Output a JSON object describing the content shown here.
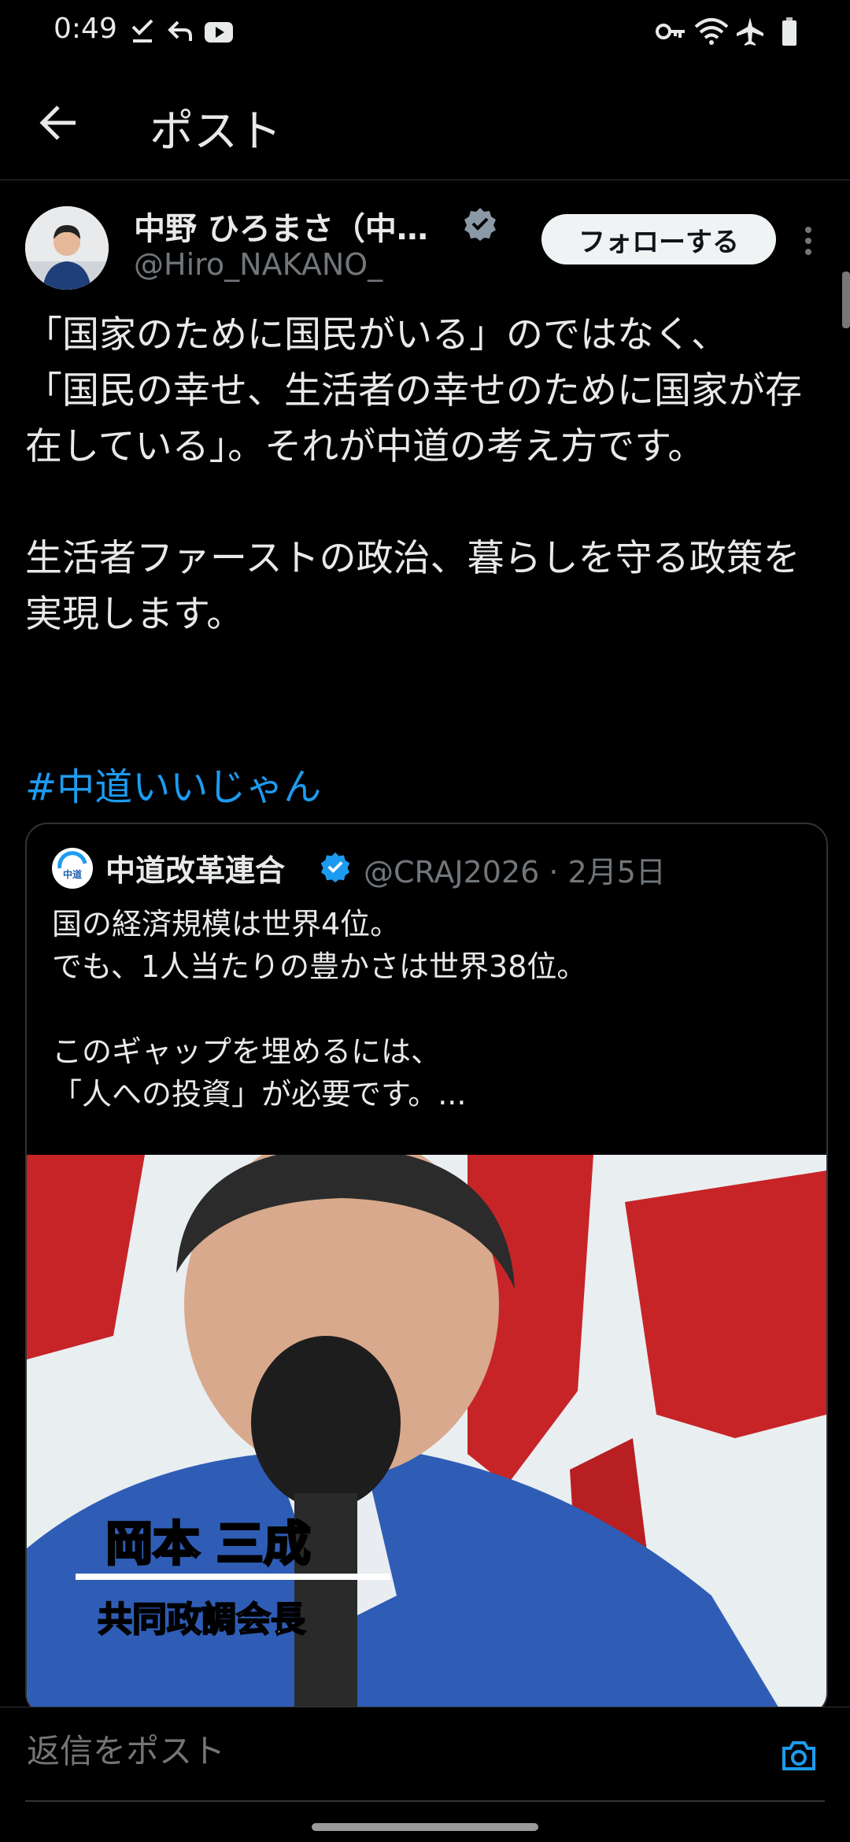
{
  "status_bar": {
    "time": "0:49",
    "icons_left": [
      "check-icon",
      "reply-arrow-icon",
      "youtube-icon"
    ],
    "icons_right": [
      "key-icon",
      "wifi-icon",
      "airplane-icon",
      "battery-icon"
    ]
  },
  "header": {
    "back_icon": "arrow-left-icon",
    "title": "ポスト"
  },
  "post": {
    "author_name": "中野 ひろまさ（中…",
    "author_handle": "@Hiro_NAKANO_",
    "follow_label": "フォローする",
    "text": "「国家のために国民がいる」のではなく、\n「国民の幸せ、生活者の幸せのために国家が存在している」。それが中道の考え方です。\n\n生活者ファーストの政治、暮らしを守る政策を実現します。",
    "hashtag": "#中道いいじゃん"
  },
  "quote": {
    "name": "中道改革連合",
    "handle_date": "@CRAJ2026 · 2月5日",
    "text": "国の経済規模は世界4位。\nでも、1人当たりの豊かさは世界38位。\n\nこのギャップを埋めるには、\n「人への投資」が必要です。...",
    "caption_name": "岡本 三成",
    "caption_title": "共同政調会長",
    "logo_text": "中道"
  },
  "reply_bar": {
    "placeholder": "返信をポスト"
  },
  "colors": {
    "background": "#000000",
    "accent": "#1d9bf0",
    "verified": "#1d9bf0",
    "text": "#e7e9ea",
    "muted": "#71767b"
  }
}
